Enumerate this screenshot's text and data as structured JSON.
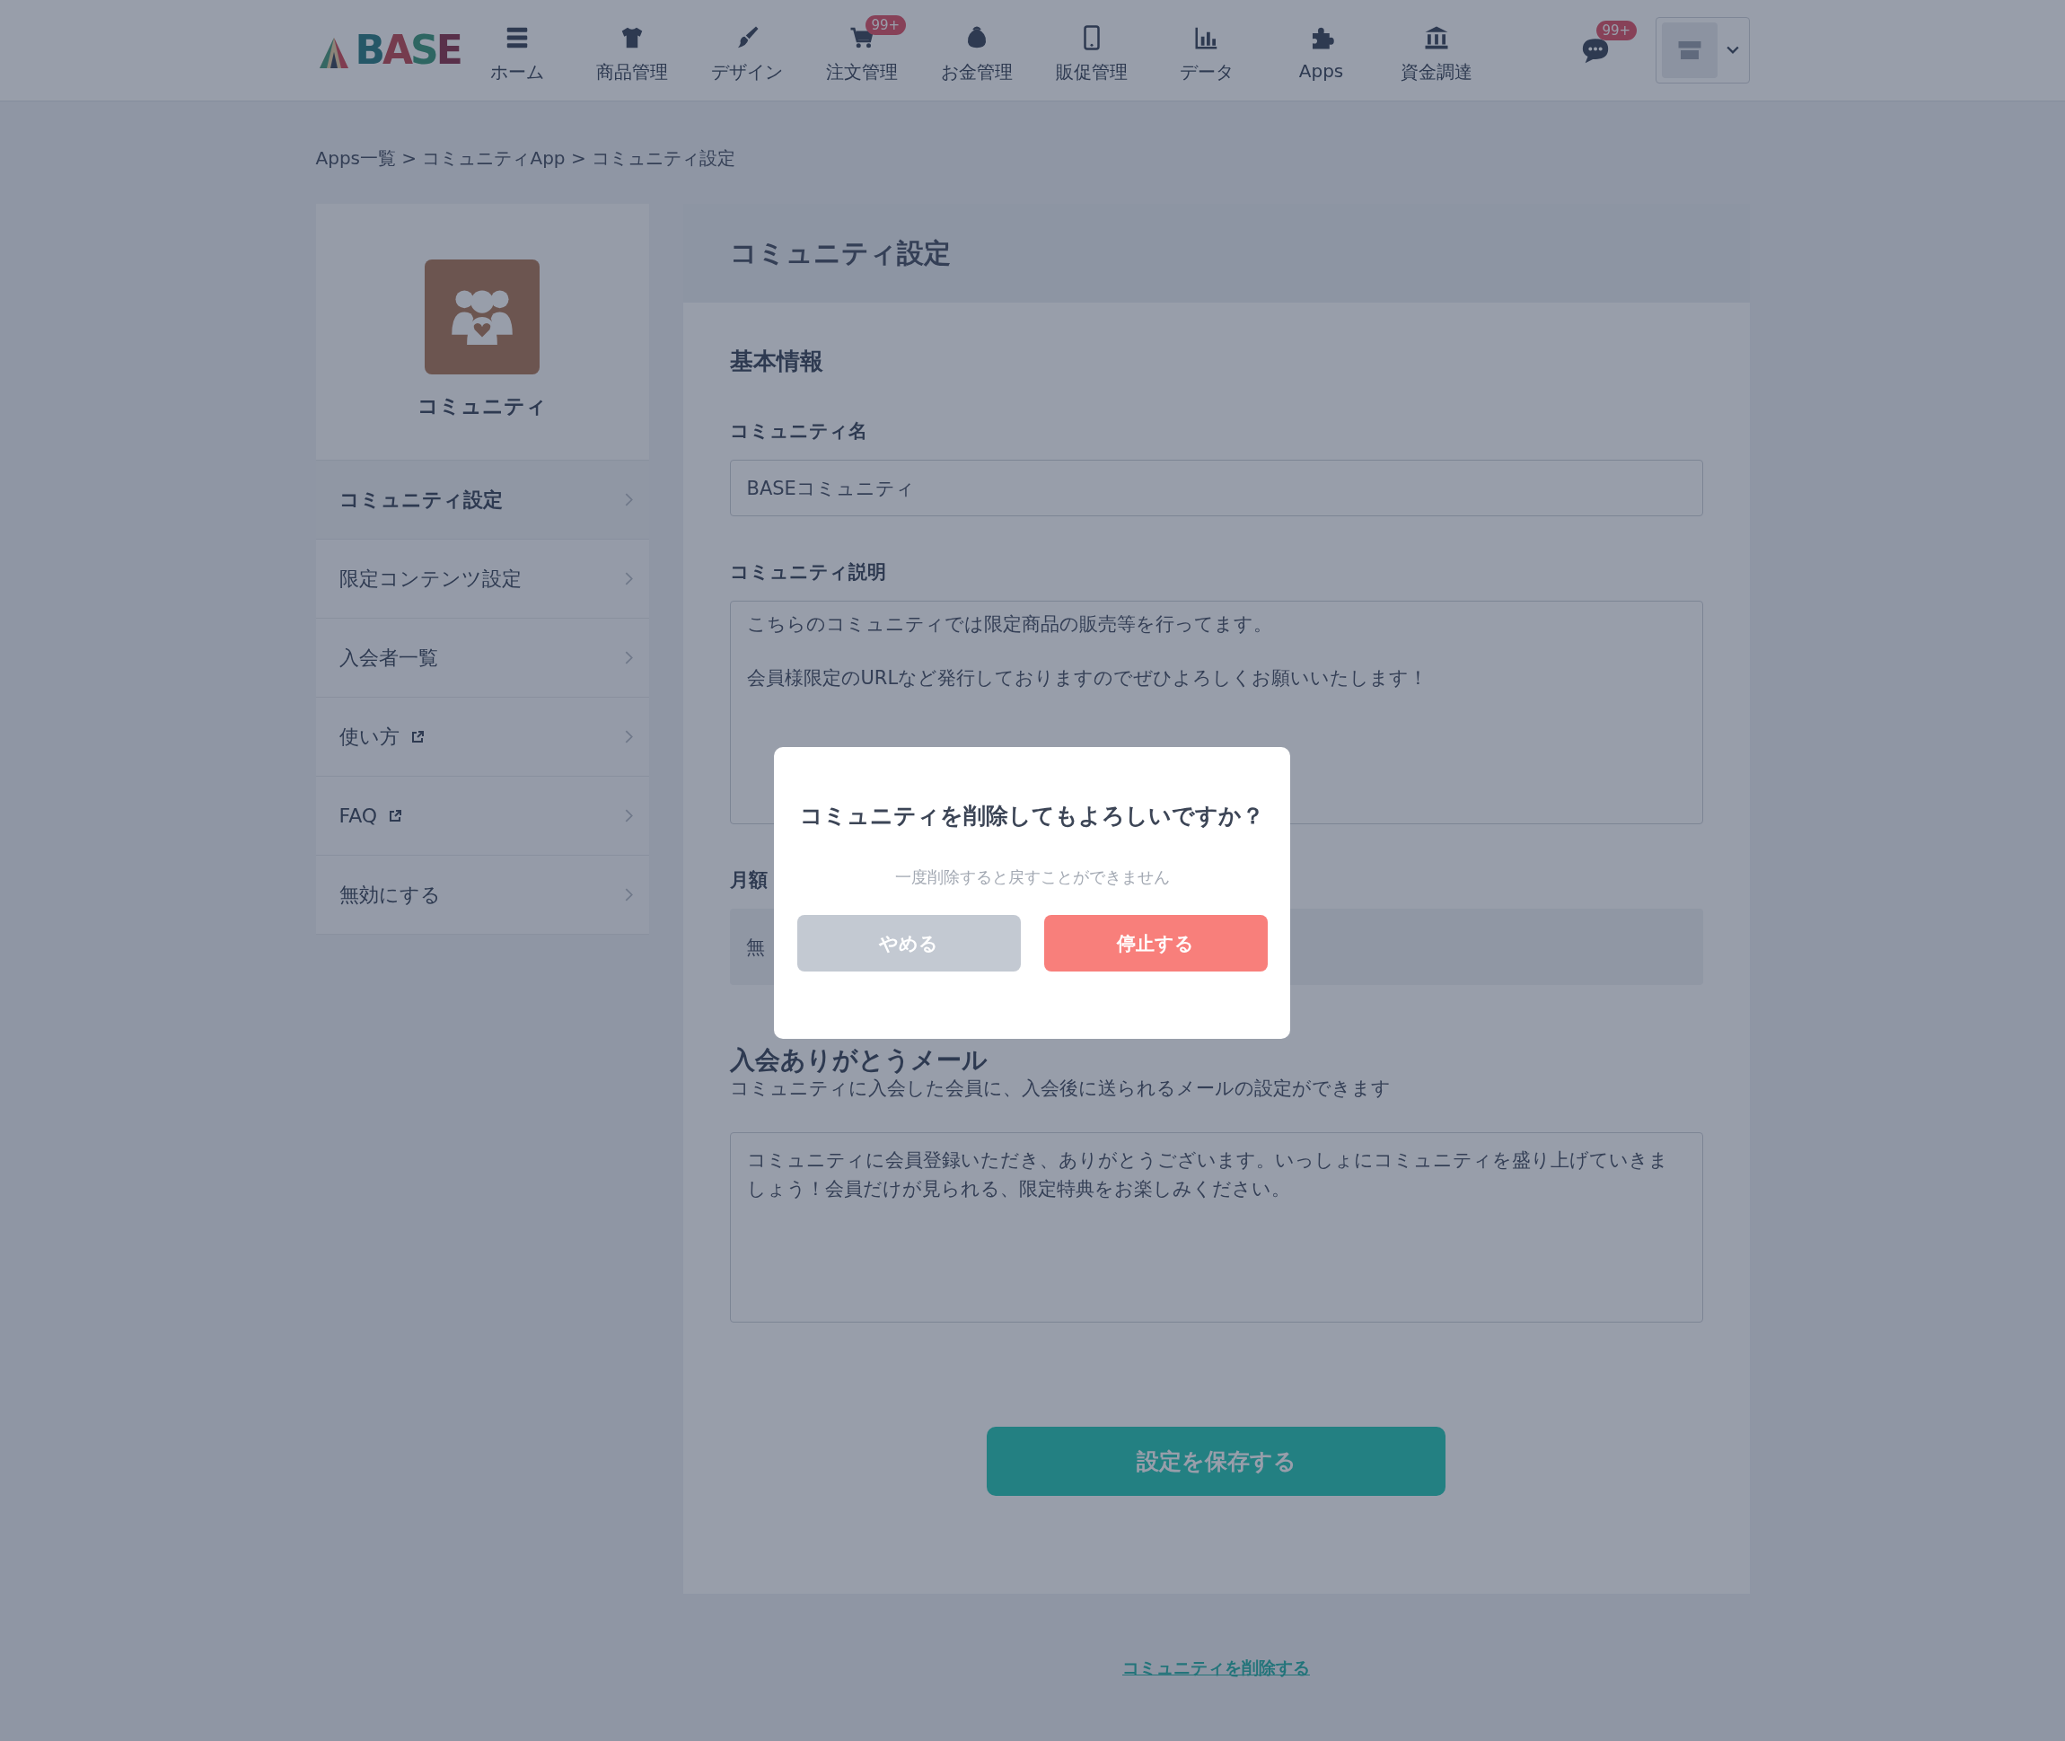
{
  "header": {
    "logo": "BASE",
    "nav": [
      {
        "label": "ホーム",
        "kind": "list"
      },
      {
        "label": "商品管理",
        "kind": "shirt"
      },
      {
        "label": "デザイン",
        "kind": "brush"
      },
      {
        "label": "注文管理",
        "kind": "cart",
        "badge": "99+"
      },
      {
        "label": "お金管理",
        "kind": "purse"
      },
      {
        "label": "販促管理",
        "kind": "phone"
      },
      {
        "label": "データ",
        "kind": "chart"
      },
      {
        "label": "Apps",
        "kind": "puzzle"
      },
      {
        "label": "資金調達",
        "kind": "bank"
      }
    ],
    "messages_badge": "99+"
  },
  "breadcrumb": "Apps一覧 > コミュニティApp > コミュニティ設定",
  "sidebar": {
    "app_name": "コミュニティ",
    "items": [
      {
        "label": "コミュニティ設定",
        "selected": true,
        "external": false
      },
      {
        "label": "限定コンテンツ設定",
        "selected": false,
        "external": false
      },
      {
        "label": "入会者一覧",
        "selected": false,
        "external": false
      },
      {
        "label": "使い方",
        "selected": false,
        "external": true
      },
      {
        "label": "FAQ",
        "selected": false,
        "external": true
      },
      {
        "label": "無効にする",
        "selected": false,
        "external": false
      }
    ]
  },
  "panel": {
    "title": "コミュニティ設定",
    "section_title": "基本情報",
    "fields": [
      {
        "kind": "input",
        "label": "コミュニティ名",
        "value": "BASEコミュニティ"
      },
      {
        "kind": "textarea",
        "label": "コミュニティ説明",
        "paragraphs": [
          "こちらのコミュニティでは限定商品の販売等を行ってます。",
          "会員様限定のURLなど発行しておりますのでぜひよろしくお願いいたします！"
        ]
      },
      {
        "kind": "select",
        "label": "月額",
        "value": "無"
      }
    ],
    "mail_section": {
      "title": "入会ありがとうメール",
      "description": "コミュニティに入会した会員に、入会後に送られるメールの設定ができます",
      "value": "コミュニティに会員登録いただき、ありがとうございます。いっしょにコミュニティを盛り上げていきましょう！会員だけが見られる、限定特典をお楽しみください。"
    },
    "save_button": "設定を保存する"
  },
  "delete_link": "コミュニティを削除する",
  "modal": {
    "title": "コミュニティを削除してもよろしいですか？",
    "message": "一度削除すると戻すことができません",
    "cancel": "やめる",
    "confirm": "停止する"
  }
}
